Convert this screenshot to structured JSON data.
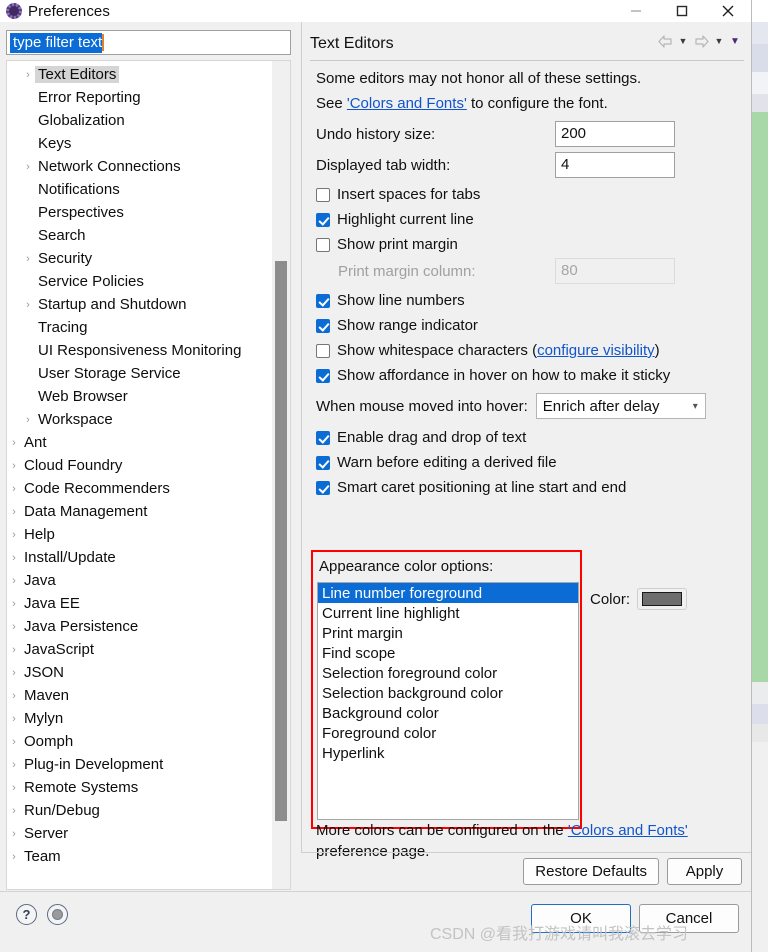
{
  "window": {
    "title": "Preferences",
    "icon": "eclipse-gear-icon",
    "controls": {
      "minimize": "─",
      "maximize": "□",
      "close": "✕"
    }
  },
  "sidebar": {
    "filter": {
      "value": "type filter text",
      "placeholder": "type filter text"
    },
    "items": [
      {
        "label": "Text Editors",
        "indent": 1,
        "expandable": true,
        "selected": true
      },
      {
        "label": "Error Reporting",
        "indent": 1,
        "expandable": false,
        "selected": false
      },
      {
        "label": "Globalization",
        "indent": 1,
        "expandable": false,
        "selected": false
      },
      {
        "label": "Keys",
        "indent": 1,
        "expandable": false,
        "selected": false
      },
      {
        "label": "Network Connections",
        "indent": 1,
        "expandable": true,
        "selected": false
      },
      {
        "label": "Notifications",
        "indent": 1,
        "expandable": false,
        "selected": false
      },
      {
        "label": "Perspectives",
        "indent": 1,
        "expandable": false,
        "selected": false
      },
      {
        "label": "Search",
        "indent": 1,
        "expandable": false,
        "selected": false
      },
      {
        "label": "Security",
        "indent": 1,
        "expandable": true,
        "selected": false
      },
      {
        "label": "Service Policies",
        "indent": 1,
        "expandable": false,
        "selected": false
      },
      {
        "label": "Startup and Shutdown",
        "indent": 1,
        "expandable": true,
        "selected": false
      },
      {
        "label": "Tracing",
        "indent": 1,
        "expandable": false,
        "selected": false
      },
      {
        "label": "UI Responsiveness Monitoring",
        "indent": 1,
        "expandable": false,
        "selected": false
      },
      {
        "label": "User Storage Service",
        "indent": 1,
        "expandable": false,
        "selected": false
      },
      {
        "label": "Web Browser",
        "indent": 1,
        "expandable": false,
        "selected": false
      },
      {
        "label": "Workspace",
        "indent": 1,
        "expandable": true,
        "selected": false
      },
      {
        "label": "Ant",
        "indent": 0,
        "expandable": true,
        "selected": false
      },
      {
        "label": "Cloud Foundry",
        "indent": 0,
        "expandable": true,
        "selected": false
      },
      {
        "label": "Code Recommenders",
        "indent": 0,
        "expandable": true,
        "selected": false
      },
      {
        "label": "Data Management",
        "indent": 0,
        "expandable": true,
        "selected": false
      },
      {
        "label": "Help",
        "indent": 0,
        "expandable": true,
        "selected": false
      },
      {
        "label": "Install/Update",
        "indent": 0,
        "expandable": true,
        "selected": false
      },
      {
        "label": "Java",
        "indent": 0,
        "expandable": true,
        "selected": false
      },
      {
        "label": "Java EE",
        "indent": 0,
        "expandable": true,
        "selected": false
      },
      {
        "label": "Java Persistence",
        "indent": 0,
        "expandable": true,
        "selected": false
      },
      {
        "label": "JavaScript",
        "indent": 0,
        "expandable": true,
        "selected": false
      },
      {
        "label": "JSON",
        "indent": 0,
        "expandable": true,
        "selected": false
      },
      {
        "label": "Maven",
        "indent": 0,
        "expandable": true,
        "selected": false
      },
      {
        "label": "Mylyn",
        "indent": 0,
        "expandable": true,
        "selected": false
      },
      {
        "label": "Oomph",
        "indent": 0,
        "expandable": true,
        "selected": false
      },
      {
        "label": "Plug-in Development",
        "indent": 0,
        "expandable": true,
        "selected": false
      },
      {
        "label": "Remote Systems",
        "indent": 0,
        "expandable": true,
        "selected": false
      },
      {
        "label": "Run/Debug",
        "indent": 0,
        "expandable": true,
        "selected": false
      },
      {
        "label": "Server",
        "indent": 0,
        "expandable": true,
        "selected": false
      },
      {
        "label": "Team",
        "indent": 0,
        "expandable": true,
        "selected": false
      }
    ]
  },
  "page": {
    "title": "Text Editors",
    "nav": {
      "back": "back-arrow",
      "forward": "forward-arrow"
    },
    "intro_1": "Some editors may not honor all of these settings.",
    "intro_2_prefix": "See ",
    "intro_2_link": "'Colors and Fonts'",
    "intro_2_suffix": " to configure the font.",
    "fields": [
      {
        "label": "Undo history size:",
        "value": "200",
        "disabled": false
      },
      {
        "label": "Displayed tab width:",
        "value": "4",
        "disabled": false
      }
    ],
    "print_margin_field": {
      "label": "Print margin column:",
      "value": "80",
      "disabled": true
    },
    "checks_group_1": [
      {
        "label": "Insert spaces for tabs",
        "checked": false
      },
      {
        "label": "Highlight current line",
        "checked": true
      },
      {
        "label": "Show print margin",
        "checked": false
      }
    ],
    "checks_group_2": [
      {
        "label": "Show line numbers",
        "checked": true
      },
      {
        "label": "Show range indicator",
        "checked": true
      }
    ],
    "whitespace": {
      "checked": false,
      "label_prefix": "Show whitespace characters (",
      "link": "configure visibility",
      "label_suffix": ")"
    },
    "affordance": {
      "label": "Show affordance in hover on how to make it sticky",
      "checked": true
    },
    "hover": {
      "label": "When mouse moved into hover:",
      "value": "Enrich after delay"
    },
    "checks_group_3": [
      {
        "label": "Enable drag and drop of text",
        "checked": true
      },
      {
        "label": "Warn before editing a derived file",
        "checked": true
      },
      {
        "label": "Smart caret positioning at line start and end",
        "checked": true
      }
    ],
    "appearance": {
      "label": "Appearance color options:",
      "options": [
        "Line number foreground",
        "Current line highlight",
        "Print margin",
        "Find scope",
        "Selection foreground color",
        "Selection background color",
        "Background color",
        "Foreground color",
        "Hyperlink"
      ],
      "selected_index": 0,
      "highlight_color": "#ff0000"
    },
    "color_picker": {
      "label": "Color:",
      "swatch": "#6e6e6e"
    },
    "more_colors": {
      "prefix": "More colors can be configured on the ",
      "link": "'Colors and Fonts'",
      "suffix": " preference page."
    },
    "buttons": {
      "restore": "Restore Defaults",
      "apply": "Apply"
    }
  },
  "footer": {
    "help_icon": "?",
    "second_icon": "filled-circle-icon",
    "ok": "OK",
    "cancel": "Cancel"
  },
  "watermark": "CSDN @看我打游戏请叫我滚去学习"
}
